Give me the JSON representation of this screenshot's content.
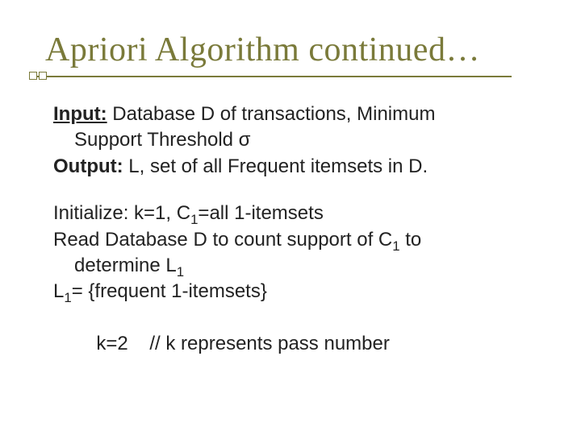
{
  "title": "Apriori Algorithm continued…",
  "input_label": "Input:",
  "input_text1": " Database D of transactions, Minimum",
  "input_text2": "Support Threshold σ",
  "output_label": "Output:",
  "output_text": " L, set of all Frequent itemsets in D.",
  "line_init_a": "Initialize: k=1, C",
  "sub1": "1",
  "line_init_b": "=all 1-itemsets",
  "line_read_a": "Read Database D to count support of C",
  "line_read_b": " to",
  "line_det_a": "determine L",
  "line_l1_a": "L",
  "line_l1_b": "= {frequent 1-itemsets}",
  "line_k2": "k=2    // k represents pass number"
}
